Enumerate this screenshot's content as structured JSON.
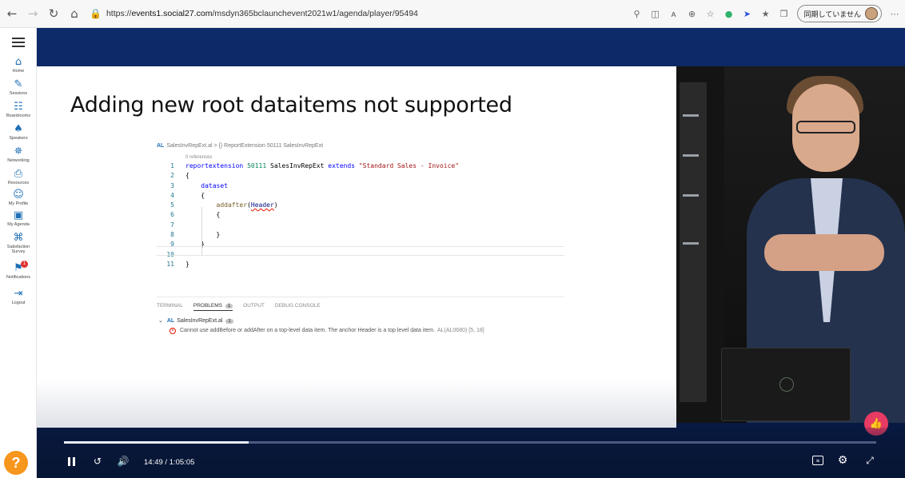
{
  "browser": {
    "url_prefix": "https://",
    "url_host": "events1.social27.com",
    "url_path": "/msdyn365bclaunchevent2021w1/agenda/player/95494",
    "profile_label": "同期していません"
  },
  "sidebar": {
    "items": [
      {
        "label": "Home",
        "icon": "house-icon",
        "glyph": "⌂"
      },
      {
        "label": "Sessions",
        "icon": "pencil-icon",
        "glyph": "✎"
      },
      {
        "label": "Boardrooms",
        "icon": "people-icon",
        "glyph": "☷"
      },
      {
        "label": "Speakers",
        "icon": "speaker-icon",
        "glyph": "♠"
      },
      {
        "label": "Networking",
        "icon": "network-icon",
        "glyph": "✵"
      },
      {
        "label": "Resources",
        "icon": "document-icon",
        "glyph": "⎙"
      },
      {
        "label": "My Profile",
        "icon": "profile-icon",
        "glyph": "☺"
      },
      {
        "label": "My Agenda",
        "icon": "calendar-icon",
        "glyph": "▣"
      },
      {
        "label": "Satisfaction Survey",
        "icon": "survey-icon",
        "glyph": "⌘"
      },
      {
        "label": "Notifications",
        "icon": "bell-icon",
        "glyph": "⚑"
      },
      {
        "label": "Logout",
        "icon": "logout-icon",
        "glyph": "⇥"
      }
    ],
    "notification_count": "1",
    "help_label": "?"
  },
  "slide": {
    "title": "Adding new root dataitems not supported",
    "breadcrumb_lang": "AL",
    "breadcrumb_file": "SalesInvRepExt.al",
    "breadcrumb_symbol": "{} ReportExtension 50111 SalesInvRepExt",
    "references": "0 references",
    "code_lines": [
      {
        "n": "1"
      },
      {
        "n": "2"
      },
      {
        "n": "3"
      },
      {
        "n": "4"
      },
      {
        "n": "5"
      },
      {
        "n": "6"
      },
      {
        "n": "7"
      },
      {
        "n": "8"
      },
      {
        "n": "9"
      },
      {
        "n": "10"
      },
      {
        "n": "11"
      }
    ],
    "code": {
      "kw_reportextension": "reportextension",
      "num_50111": "50111",
      "name": "SalesInvRepExt",
      "kw_extends": "extends",
      "str_base": "\"Standard Sales - Invoice\"",
      "open_brace": "{",
      "close_brace": "}",
      "kw_dataset": "dataset",
      "fn_addafter": "addafter",
      "arg_header": "Header"
    },
    "panel": {
      "tabs": [
        "TERMINAL",
        "PROBLEMS",
        "OUTPUT",
        "DEBUG CONSOLE"
      ],
      "problems_count": "1",
      "file_lang": "AL",
      "file_name": "SalesInvRepExt.al",
      "file_count": "1",
      "message": "Cannot use addBefore or addAfter on a top-level data item. The anchor Header is a top level data item.",
      "message_code": "AL(AL0680) [5, 18]"
    }
  },
  "player": {
    "time_current": "14:49",
    "time_separator": "/",
    "time_total": "1:05:05",
    "progress": 0.2277,
    "accent_like": "#e83b63"
  }
}
